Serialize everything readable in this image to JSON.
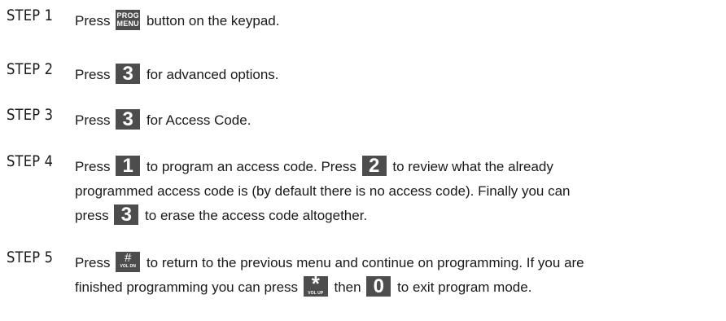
{
  "steps": [
    {
      "label": "STEP 1",
      "press": "Press",
      "key": {
        "top": "PROG",
        "bottom": "MENU"
      },
      "text": "button on the keypad."
    },
    {
      "label": "STEP 2",
      "press": "Press",
      "key": "3",
      "text": "for advanced options."
    },
    {
      "label": "STEP 3",
      "press": "Press",
      "key": "3",
      "text": "for Access Code."
    },
    {
      "label": "STEP 4",
      "press1": "Press",
      "key1": "1",
      "text1": "to program an access code.  Press",
      "key2": "2",
      "text2": " to review what the already",
      "line2": "programmed access code is (by default there is no access code).  Finally you can",
      "line3_pre": "press",
      "key3": "3",
      "line3_post": "to erase the access code altogether."
    },
    {
      "label": "STEP 5",
      "press": "Press",
      "key_hash": {
        "symbol": "#",
        "sub": "VOL DN"
      },
      "text1": "to return to the previous menu and continue on programming.  If you are",
      "line2_pre": "finished programming you can press",
      "key_star": {
        "symbol": "*",
        "sub": "VOL UP"
      },
      "line2_mid": "then",
      "key_zero": "0",
      "line2_post": "to exit program mode."
    }
  ],
  "colors": {
    "text": "#1a1a1a",
    "key_background": "#4d4d4d",
    "key_text": "#ffffff"
  }
}
